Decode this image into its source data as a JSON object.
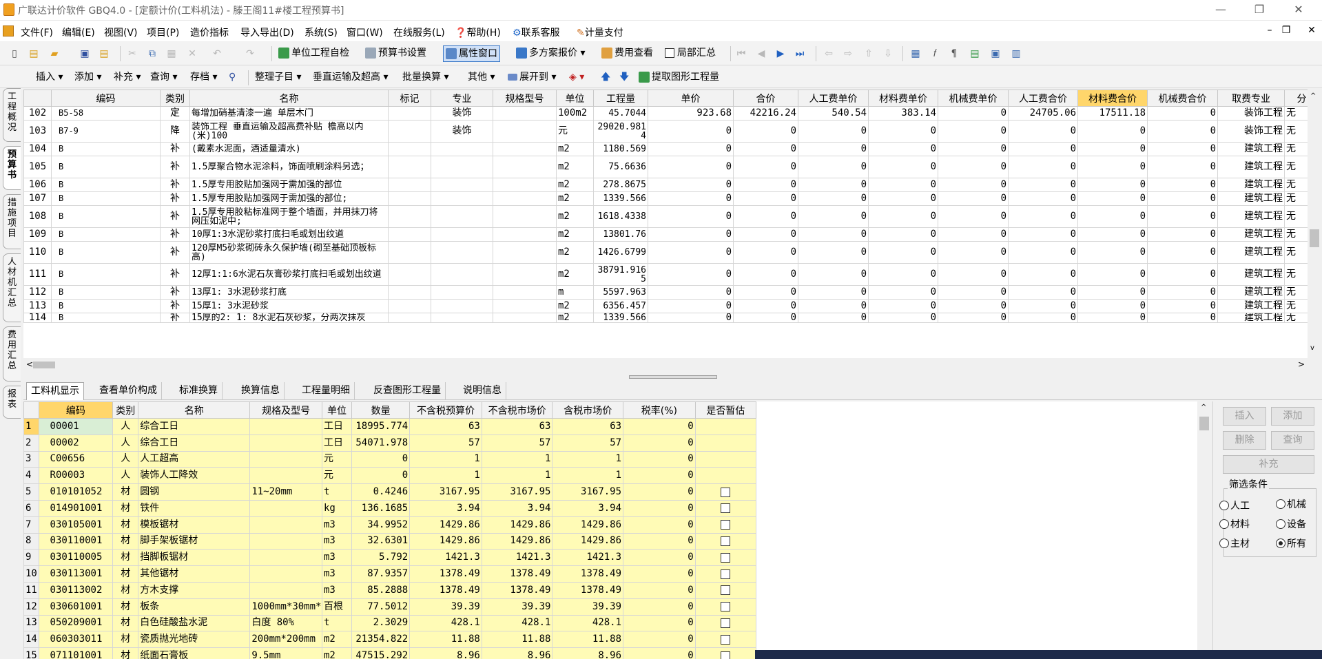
{
  "window": {
    "title": "广联达计价软件 GBQ4.0 - [定额计价(工料机法) - 滕王阁11#楼工程预算书]",
    "min": "—",
    "restore": "❐",
    "close": "✕"
  },
  "menu": [
    "文件(F)",
    "编辑(E)",
    "视图(V)",
    "项目(P)",
    "造价指标",
    "导入导出(D)",
    "系统(S)",
    "窗口(W)",
    "在线服务(L)",
    "帮助(H)",
    "联系客服",
    "计量支付"
  ],
  "mdi": {
    "min": "–",
    "restore": "❐",
    "close": "✕"
  },
  "toolbar1": {
    "check": "单位工程自检",
    "settings": "预算书设置",
    "props": "属性窗口",
    "multi": "多方案报价",
    "fee": "费用查看",
    "partial": "局部汇总"
  },
  "toolbar2": {
    "insert": "插入",
    "add": "添加",
    "supplement": "补充",
    "query": "查询",
    "archive": "存档",
    "tidy": "整理子目",
    "vertical": "垂直运输及超高",
    "batch": "批量换算",
    "other": "其他",
    "expand": "展开到",
    "extract": "提取图形工程量"
  },
  "left_tabs": [
    "工程概况",
    "预算书",
    "措施项目",
    "人材机汇总",
    "费用汇总",
    "报表"
  ],
  "top_table": {
    "headers": [
      "",
      "编码",
      "类别",
      "名称",
      "标记",
      "专业",
      "规格型号",
      "单位",
      "工程量",
      "单价",
      "合价",
      "人工费单价",
      "材料费单价",
      "机械费单价",
      "人工费合价",
      "材料费合价",
      "机械费合价",
      "取费专业",
      "分"
    ],
    "rows": [
      [
        "102",
        "B5-58",
        "定",
        "每增加硝基清漆一遍 单层木门",
        "",
        "装饰",
        "",
        "100m2",
        "45.7044",
        "923.68",
        "42216.24",
        "540.54",
        "383.14",
        "0",
        "24705.06",
        "17511.18",
        "0",
        "装饰工程",
        "无"
      ],
      [
        "103",
        "B7-9",
        "降",
        "装饰工程 垂直运输及超高费补贴 檐高以内(米)100",
        "",
        "装饰",
        "",
        "元",
        "29020.9814",
        "0",
        "0",
        "0",
        "0",
        "0",
        "0",
        "0",
        "0",
        "装饰工程",
        "无"
      ],
      [
        "104",
        "B",
        "补",
        "(戴素水泥面，酒适量清水)",
        "",
        "",
        "",
        "m2",
        "1180.569",
        "0",
        "0",
        "0",
        "0",
        "0",
        "0",
        "0",
        "0",
        "建筑工程",
        "无"
      ],
      [
        "105",
        "B",
        "补",
        "1.5厚聚合物水泥涂料，饰面喷刷涂料另选；",
        "",
        "",
        "",
        "m2",
        "75.6636",
        "0",
        "0",
        "0",
        "0",
        "0",
        "0",
        "0",
        "0",
        "建筑工程",
        "无"
      ],
      [
        "106",
        "B",
        "补",
        "1.5厚专用胶贴加强网于需加强的部位",
        "",
        "",
        "",
        "m2",
        "278.8675",
        "0",
        "0",
        "0",
        "0",
        "0",
        "0",
        "0",
        "0",
        "建筑工程",
        "无"
      ],
      [
        "107",
        "B",
        "补",
        "1.5厚专用胶贴加强网于需加强的部位;",
        "",
        "",
        "",
        "m2",
        "1339.566",
        "0",
        "0",
        "0",
        "0",
        "0",
        "0",
        "0",
        "0",
        "建筑工程",
        "无"
      ],
      [
        "108",
        "B",
        "补",
        "1.5厚专用胶粘标准网于整个墙面，并用抹刀将网压如泥中;",
        "",
        "",
        "",
        "m2",
        "1618.4338",
        "0",
        "0",
        "0",
        "0",
        "0",
        "0",
        "0",
        "0",
        "建筑工程",
        "无"
      ],
      [
        "109",
        "B",
        "补",
        "10厚1:3水泥砂浆打底扫毛或划出纹道",
        "",
        "",
        "",
        "m2",
        "13801.76",
        "0",
        "0",
        "0",
        "0",
        "0",
        "0",
        "0",
        "0",
        "建筑工程",
        "无"
      ],
      [
        "110",
        "B",
        "补",
        "120厚M5砂浆砌砖永久保护墙(砌至基础顶板标高)",
        "",
        "",
        "",
        "m2",
        "1426.6799",
        "0",
        "0",
        "0",
        "0",
        "0",
        "0",
        "0",
        "0",
        "建筑工程",
        "无"
      ],
      [
        "111",
        "B",
        "补",
        "12厚1:1:6水泥石灰膏砂浆打底扫毛或划出纹道",
        "",
        "",
        "",
        "m2",
        "38791.9165",
        "0",
        "0",
        "0",
        "0",
        "0",
        "0",
        "0",
        "0",
        "建筑工程",
        "无"
      ],
      [
        "112",
        "B",
        "补",
        "13厚1: 3水泥砂浆打底",
        "",
        "",
        "",
        "m",
        "5597.963",
        "0",
        "0",
        "0",
        "0",
        "0",
        "0",
        "0",
        "0",
        "建筑工程",
        "无"
      ],
      [
        "113",
        "B",
        "补",
        "15厚1: 3水泥砂浆",
        "",
        "",
        "",
        "m2",
        "6356.457",
        "0",
        "0",
        "0",
        "0",
        "0",
        "0",
        "0",
        "0",
        "建筑工程",
        "无"
      ],
      [
        "114",
        "B",
        "补",
        "15厚的2: 1: 8水泥石灰砂浆，分两次抹灰",
        "",
        "",
        "",
        "m2",
        "1339.566",
        "0",
        "0",
        "0",
        "0",
        "0",
        "0",
        "0",
        "0",
        "建筑工程",
        "无"
      ]
    ]
  },
  "bottom_tabs": [
    "工料机显示",
    "查看单价构成",
    "标准换算",
    "换算信息",
    "工程量明细",
    "反查图形工程量",
    "说明信息"
  ],
  "bottom_table": {
    "headers": [
      "",
      "编码",
      "类别",
      "名称",
      "规格及型号",
      "单位",
      "数量",
      "不含税预算价",
      "不含税市场价",
      "含税市场价",
      "税率(%)",
      "是否暂估"
    ],
    "rows": [
      [
        "1",
        "00001",
        "人",
        "综合工日",
        "",
        "工日",
        "18995.774",
        "63",
        "63",
        "63",
        "0",
        ""
      ],
      [
        "2",
        "00002",
        "人",
        "综合工日",
        "",
        "工日",
        "54071.978",
        "57",
        "57",
        "57",
        "0",
        ""
      ],
      [
        "3",
        "C00656",
        "人",
        "人工超高",
        "",
        "元",
        "0",
        "1",
        "1",
        "1",
        "0",
        ""
      ],
      [
        "4",
        "R00003",
        "人",
        "装饰人工降效",
        "",
        "元",
        "0",
        "1",
        "1",
        "1",
        "0",
        ""
      ],
      [
        "5",
        "010101052",
        "材",
        "圆钢",
        "11~20mm",
        "t",
        "0.4246",
        "3167.95",
        "3167.95",
        "3167.95",
        "0",
        "box"
      ],
      [
        "6",
        "014901001",
        "材",
        "铁件",
        "",
        "kg",
        "136.1685",
        "3.94",
        "3.94",
        "3.94",
        "0",
        "box"
      ],
      [
        "7",
        "030105001",
        "材",
        "模板锯材",
        "",
        "m3",
        "34.9952",
        "1429.86",
        "1429.86",
        "1429.86",
        "0",
        "box"
      ],
      [
        "8",
        "030110001",
        "材",
        "脚手架板锯材",
        "",
        "m3",
        "32.6301",
        "1429.86",
        "1429.86",
        "1429.86",
        "0",
        "box"
      ],
      [
        "9",
        "030110005",
        "材",
        "挡脚板锯材",
        "",
        "m3",
        "5.792",
        "1421.3",
        "1421.3",
        "1421.3",
        "0",
        "box"
      ],
      [
        "10",
        "030113001",
        "材",
        "其他锯材",
        "",
        "m3",
        "87.9357",
        "1378.49",
        "1378.49",
        "1378.49",
        "0",
        "box"
      ],
      [
        "11",
        "030113002",
        "材",
        "方木支撑",
        "",
        "m3",
        "85.2888",
        "1378.49",
        "1378.49",
        "1378.49",
        "0",
        "box"
      ],
      [
        "12",
        "030601001",
        "材",
        "板条",
        "1000mm*30mm*",
        "百根",
        "77.5012",
        "39.39",
        "39.39",
        "39.39",
        "0",
        "box"
      ],
      [
        "13",
        "050209001",
        "材",
        "白色硅酸盐水泥",
        "白度 80%",
        "t",
        "2.3029",
        "428.1",
        "428.1",
        "428.1",
        "0",
        "box"
      ],
      [
        "14",
        "060303011",
        "材",
        "瓷质抛光地砖",
        "200mm*200mm",
        "m2",
        "21354.822",
        "11.88",
        "11.88",
        "11.88",
        "0",
        "box"
      ],
      [
        "15",
        "071101001",
        "材",
        "纸面石膏板",
        "9.5mm",
        "m2",
        "47515.292",
        "8.96",
        "8.96",
        "8.96",
        "0",
        "box"
      ]
    ]
  },
  "right_panel": {
    "insert": "插入",
    "add": "添加",
    "delete": "删除",
    "query": "查询",
    "supplement": "补充",
    "filter_title": "筛选条件",
    "filters": [
      "人工",
      "机械",
      "材料",
      "设备",
      "主材",
      "所有"
    ],
    "selected": "所有"
  }
}
